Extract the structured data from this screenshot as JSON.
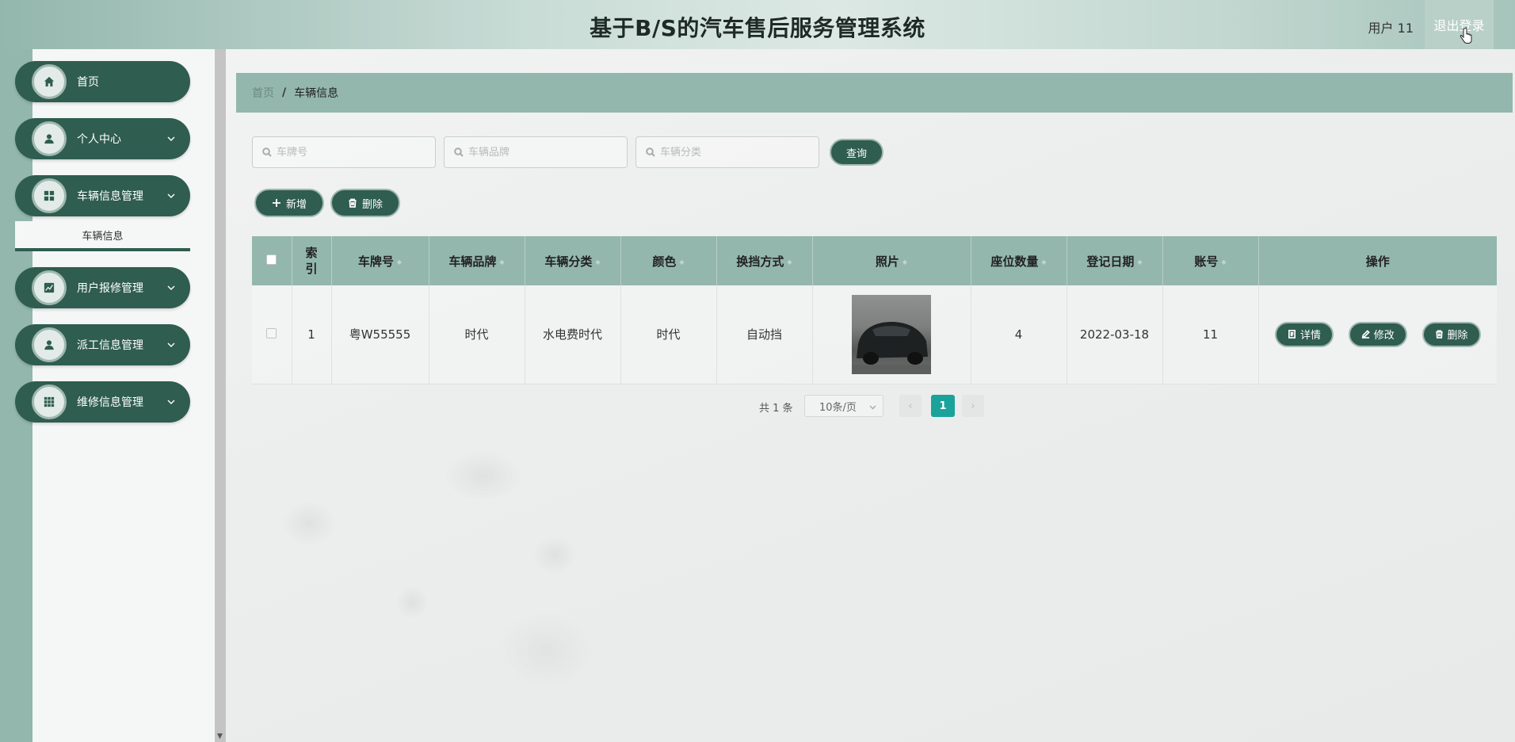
{
  "header": {
    "title": "基于B/S的汽车售后服务管理系统",
    "user": "用户 11",
    "logout": "退出登录"
  },
  "sidebar": {
    "items": [
      {
        "label": "首页",
        "icon": "home-icon"
      },
      {
        "label": "个人中心",
        "icon": "user-icon"
      },
      {
        "label": "车辆信息管理",
        "icon": "grid-icon"
      },
      {
        "label": "用户报修管理",
        "icon": "chart-icon"
      },
      {
        "label": "派工信息管理",
        "icon": "user-icon"
      },
      {
        "label": "维修信息管理",
        "icon": "apps-icon"
      }
    ],
    "submenu": "车辆信息"
  },
  "breadcrumb": {
    "home": "首页",
    "sep": "/",
    "current": "车辆信息"
  },
  "search": {
    "plate_placeholder": "车牌号",
    "brand_placeholder": "车辆品牌",
    "category_placeholder": "车辆分类",
    "query": "查询"
  },
  "actions": {
    "add": "新增",
    "delete": "删除"
  },
  "table": {
    "headers": [
      "索\n引",
      "车牌号",
      "车辆品牌",
      "车辆分类",
      "颜色",
      "换挡方式",
      "照片",
      "座位数量",
      "登记日期",
      "账号",
      "操作"
    ],
    "rows": [
      {
        "index": "1",
        "plate": "粤W55555",
        "brand": "时代",
        "category": "水电费时代",
        "color": "时代",
        "gear": "自动挡",
        "seats": "4",
        "date": "2022-03-18",
        "account": "11"
      }
    ],
    "ops": {
      "detail": "详情",
      "edit": "修改",
      "delete": "删除"
    }
  },
  "pager": {
    "total": "共 1 条",
    "size": "10条/页",
    "page": "1",
    "prev": "‹",
    "next": "›"
  },
  "colors": {
    "primary": "#2f5d50",
    "header": "#93b7ad",
    "page_active": "#1aa39a"
  }
}
